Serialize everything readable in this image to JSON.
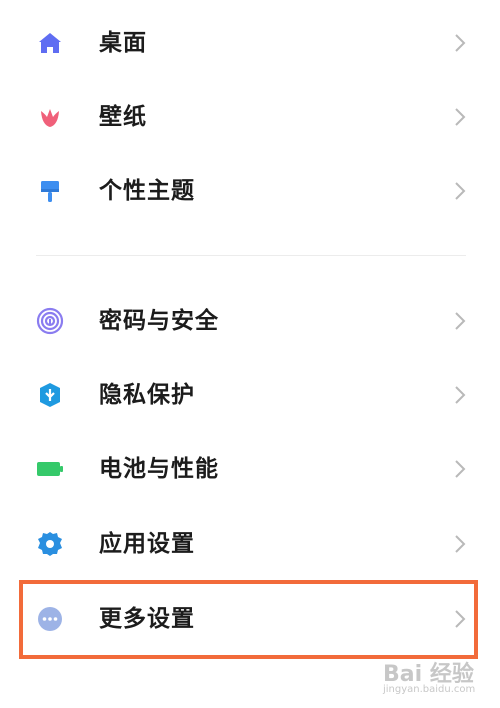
{
  "sections": [
    {
      "items": [
        {
          "label": "桌面",
          "icon": "home-icon",
          "icon_color": "#5f6df2"
        },
        {
          "label": "壁纸",
          "icon": "tulip-icon",
          "icon_color": "#f0607a"
        },
        {
          "label": "个性主题",
          "icon": "paint-brush-icon",
          "icon_color": "#3d8ef0"
        }
      ]
    },
    {
      "items": [
        {
          "label": "密码与安全",
          "icon": "fingerprint-icon",
          "icon_color": "#8a7cf0"
        },
        {
          "label": "隐私保护",
          "icon": "shield-icon",
          "icon_color": "#1f9ae0"
        },
        {
          "label": "电池与性能",
          "icon": "battery-icon",
          "icon_color": "#35c96a"
        },
        {
          "label": "应用设置",
          "icon": "gear-icon",
          "icon_color": "#2a8fe0"
        },
        {
          "label": "更多设置",
          "icon": "more-dots-icon",
          "icon_color": "#9db3e6"
        }
      ]
    }
  ],
  "highlight": {
    "target": "更多设置",
    "color": "#f26b3a"
  },
  "watermark": {
    "text": "Bai 经验",
    "sub": "jingyan.baidu.com"
  }
}
